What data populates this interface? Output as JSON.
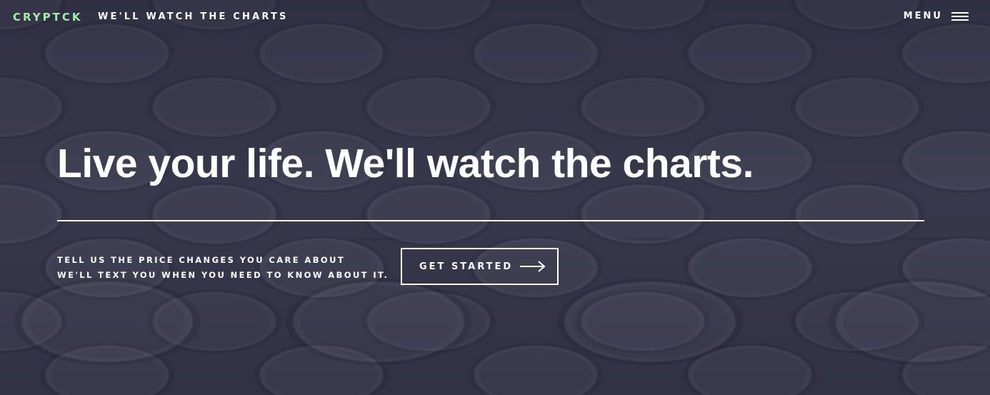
{
  "header": {
    "brand": "CRYPTCK",
    "tagline": "WE'LL WATCH THE CHARTS",
    "menu_label": "MENU",
    "menu_icon": "hamburger-icon"
  },
  "hero": {
    "headline": "Live your life. We'll watch the charts.",
    "subtext_line1": "TELL US THE PRICE CHANGES YOU CARE ABOUT",
    "subtext_line2": "WE'LL TEXT YOU WHEN YOU NEED TO KNOW ABOUT IT.",
    "cta_label": "GET STARTED",
    "cta_icon": "arrow-right-icon"
  },
  "colors": {
    "brand": "#9ef0a4",
    "text": "#ffffff",
    "background": "#3a394e"
  }
}
